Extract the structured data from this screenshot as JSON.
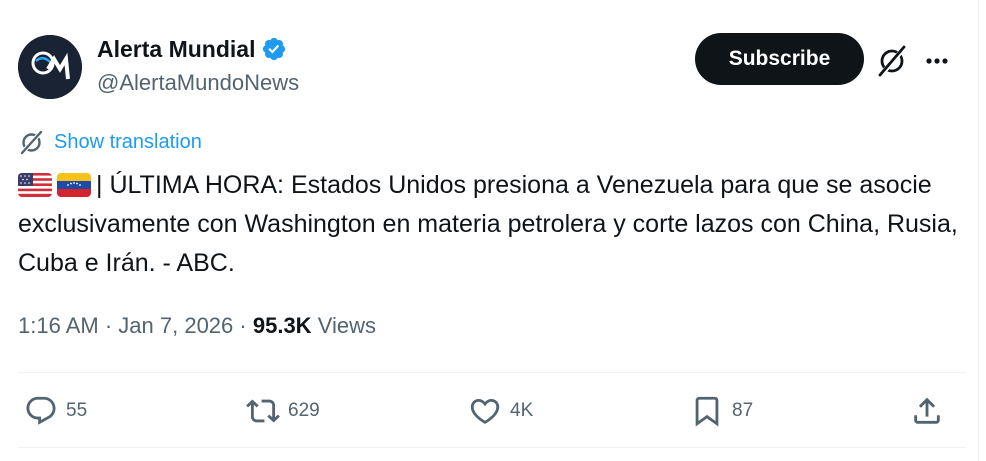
{
  "author": {
    "display_name": "Alerta Mundial",
    "handle": "@AlertaMundoNews",
    "avatar_icon": "alerta-mundial-logo",
    "verified_icon": "verified-badge-icon"
  },
  "header": {
    "subscribe_label": "Subscribe",
    "grok_icon": "grok-icon",
    "more_icon": "more-icon"
  },
  "translation": {
    "label": "Show translation",
    "icon": "translate-icon"
  },
  "tweet": {
    "flags": [
      "us-flag",
      "venezuela-flag"
    ],
    "text": "| ÚLTIMA HORA: Estados Unidos presiona a Venezuela para que se asocie exclusivamente con Washington en materia petrolera y corte lazos con China, Rusia, Cuba e Irán. - ABC."
  },
  "meta": {
    "time": "1:16 AM",
    "separator": "·",
    "date": "Jan 7, 2026",
    "views_count": "95.3K",
    "views_label": "Views"
  },
  "actions": {
    "replies": "55",
    "reposts": "629",
    "likes": "4K",
    "bookmarks": "87"
  },
  "colors": {
    "accent": "#1d9bf0",
    "text": "#0f1419",
    "secondary": "#536471",
    "divider": "#eff3f4",
    "subscribe_bg": "#0f1419"
  }
}
